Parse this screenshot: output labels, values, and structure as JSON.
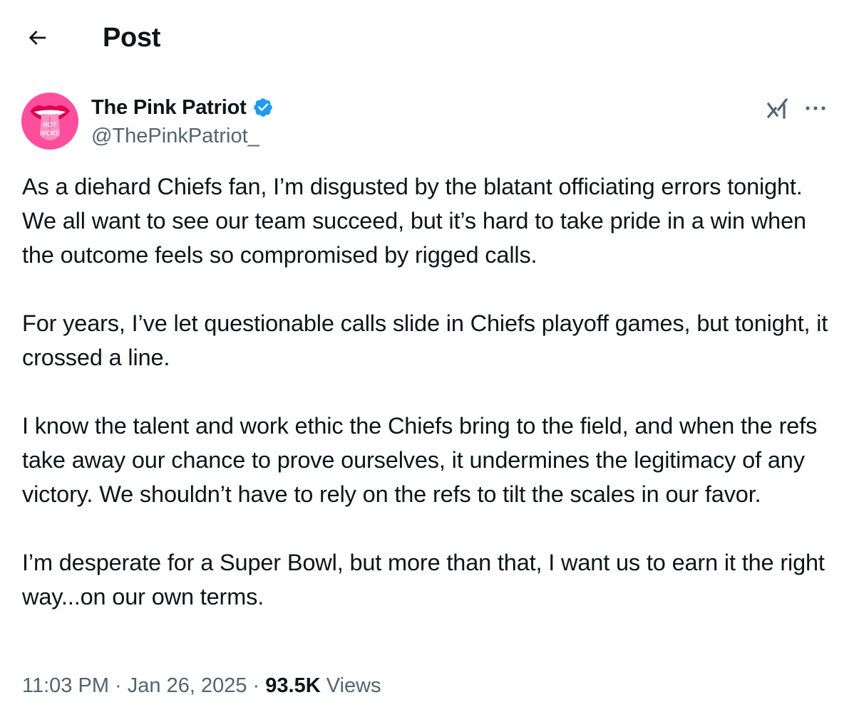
{
  "header": {
    "title": "Post",
    "back_icon": "arrow-left-icon"
  },
  "author": {
    "name": "The Pink Patriot",
    "handle": "@ThePinkPatriot_",
    "verified": true,
    "verified_color": "#1d9bf0",
    "avatar_logo_text": "NOT WOKE",
    "avatar_color": "#ff4f9c"
  },
  "actions": {
    "grok_icon": "grok-icon",
    "more_icon": "more-horizontal-icon"
  },
  "post": {
    "paragraphs": [
      "As a diehard Chiefs fan, I’m disgusted by the blatant officiating errors tonight. We all want to see our team succeed, but it’s hard to take pride in a win when the outcome feels so compromised by rigged calls.",
      "For years, I’ve let questionable calls slide in Chiefs playoff games, but tonight, it crossed a line.",
      "I know the talent and work ethic the Chiefs bring to the field, and when the refs take away our chance to prove ourselves, it undermines the legitimacy of any victory. We shouldn’t have to rely on the refs to tilt the scales in our favor.",
      "I’m desperate for a Super Bowl, but more than that, I want us to earn it the right way...on our own terms."
    ]
  },
  "meta": {
    "time": "11:03 PM",
    "separator": " · ",
    "date": "Jan 26, 2025",
    "views_count": "93.5K",
    "views_label": "Views"
  }
}
